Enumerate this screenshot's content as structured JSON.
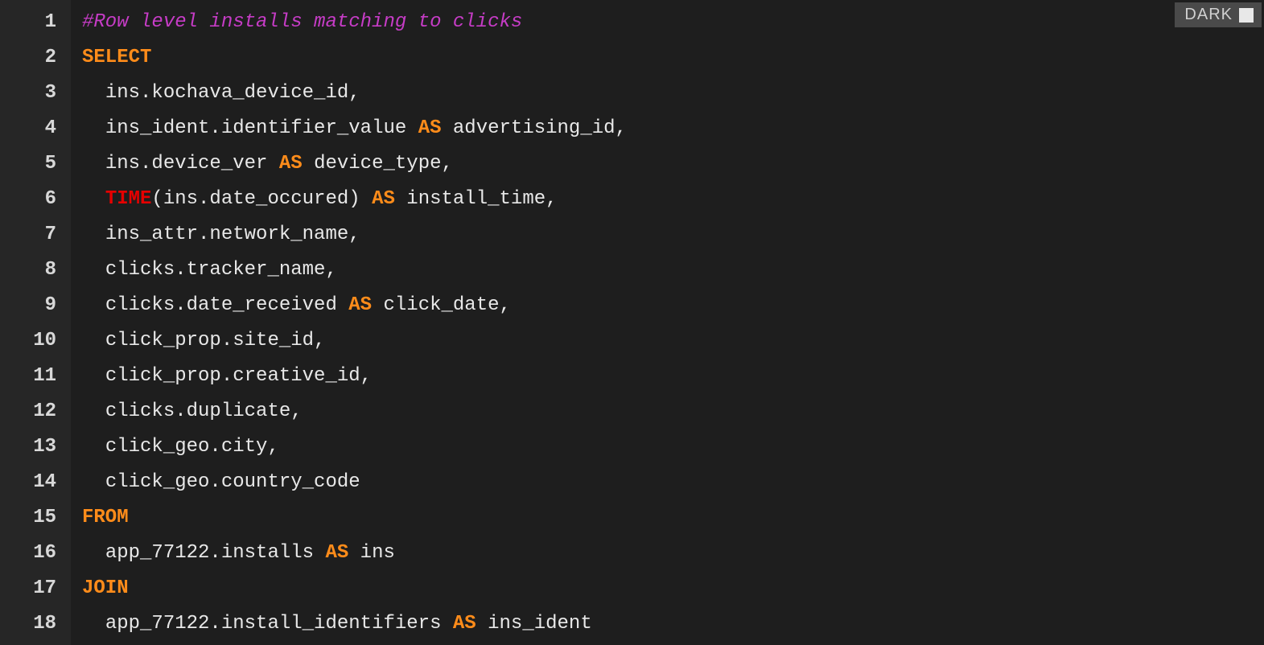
{
  "theme_toggle": {
    "label": "DARK"
  },
  "lines": [
    {
      "n": "1",
      "indent": 0,
      "tokens": [
        {
          "cls": "tok-comment",
          "t": "#Row level installs matching to clicks"
        }
      ]
    },
    {
      "n": "2",
      "indent": 0,
      "tokens": [
        {
          "cls": "tok-keyword",
          "t": "SELECT"
        }
      ]
    },
    {
      "n": "3",
      "indent": 1,
      "tokens": [
        {
          "cls": "tok-text",
          "t": "ins.kochava_device_id,"
        }
      ]
    },
    {
      "n": "4",
      "indent": 1,
      "tokens": [
        {
          "cls": "tok-text",
          "t": "ins_ident.identifier_value "
        },
        {
          "cls": "tok-keyword",
          "t": "AS"
        },
        {
          "cls": "tok-text",
          "t": " advertising_id,"
        }
      ]
    },
    {
      "n": "5",
      "indent": 1,
      "tokens": [
        {
          "cls": "tok-text",
          "t": "ins.device_ver "
        },
        {
          "cls": "tok-keyword",
          "t": "AS"
        },
        {
          "cls": "tok-text",
          "t": " device_type,"
        }
      ]
    },
    {
      "n": "6",
      "indent": 1,
      "tokens": [
        {
          "cls": "tok-func",
          "t": "TIME"
        },
        {
          "cls": "tok-text",
          "t": "(ins.date_occured) "
        },
        {
          "cls": "tok-keyword",
          "t": "AS"
        },
        {
          "cls": "tok-text",
          "t": " install_time,"
        }
      ]
    },
    {
      "n": "7",
      "indent": 1,
      "tokens": [
        {
          "cls": "tok-text",
          "t": "ins_attr.network_name,"
        }
      ]
    },
    {
      "n": "8",
      "indent": 1,
      "tokens": [
        {
          "cls": "tok-text",
          "t": "clicks.tracker_name,"
        }
      ]
    },
    {
      "n": "9",
      "indent": 1,
      "tokens": [
        {
          "cls": "tok-text",
          "t": "clicks.date_received "
        },
        {
          "cls": "tok-keyword",
          "t": "AS"
        },
        {
          "cls": "tok-text",
          "t": " click_date,"
        }
      ]
    },
    {
      "n": "10",
      "indent": 1,
      "tokens": [
        {
          "cls": "tok-text",
          "t": "click_prop.site_id,"
        }
      ]
    },
    {
      "n": "11",
      "indent": 1,
      "tokens": [
        {
          "cls": "tok-text",
          "t": "click_prop.creative_id,"
        }
      ]
    },
    {
      "n": "12",
      "indent": 1,
      "tokens": [
        {
          "cls": "tok-text",
          "t": "clicks.duplicate,"
        }
      ]
    },
    {
      "n": "13",
      "indent": 1,
      "tokens": [
        {
          "cls": "tok-text",
          "t": "click_geo.city,"
        }
      ]
    },
    {
      "n": "14",
      "indent": 1,
      "tokens": [
        {
          "cls": "tok-text",
          "t": "click_geo.country_code"
        }
      ]
    },
    {
      "n": "15",
      "indent": 0,
      "tokens": [
        {
          "cls": "tok-keyword",
          "t": "FROM"
        }
      ]
    },
    {
      "n": "16",
      "indent": 1,
      "tokens": [
        {
          "cls": "tok-text",
          "t": "app_77122.installs "
        },
        {
          "cls": "tok-keyword",
          "t": "AS"
        },
        {
          "cls": "tok-text",
          "t": " ins"
        }
      ]
    },
    {
      "n": "17",
      "indent": 0,
      "tokens": [
        {
          "cls": "tok-keyword",
          "t": "JOIN"
        }
      ]
    },
    {
      "n": "18",
      "indent": 1,
      "tokens": [
        {
          "cls": "tok-text",
          "t": "app_77122.install_identifiers "
        },
        {
          "cls": "tok-keyword",
          "t": "AS"
        },
        {
          "cls": "tok-text",
          "t": " ins_ident"
        }
      ]
    }
  ]
}
